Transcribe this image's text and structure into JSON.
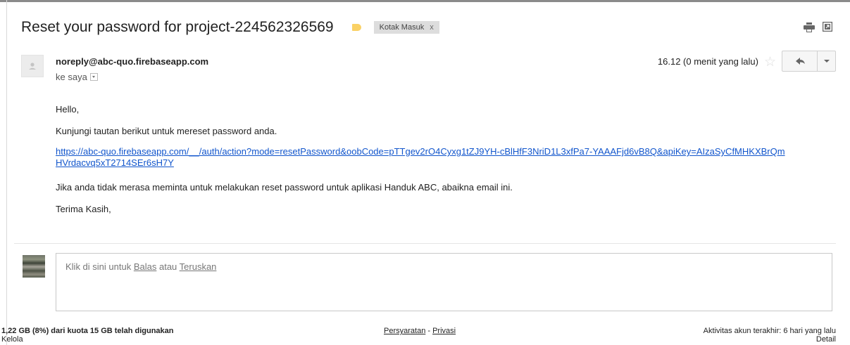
{
  "email": {
    "subject": "Reset your password for project-224562326569",
    "label_chip": "Kotak Masuk",
    "label_chip_close": "x",
    "sender": "noreply@abc-quo.firebaseapp.com",
    "recipient": "ke saya",
    "time": "16.12 (0 menit yang lalu)",
    "body": {
      "greeting": "Hello,",
      "line1": "Kunjungi tautan berikut untuk mereset password anda.",
      "link": "https://abc-quo.firebaseapp.com/__/auth/action?mode=resetPassword&oobCode=pTTgev2rO4Cyxg1tZJ9YH-cBlHfF3NriD1L3xfPa7-YAAAFjd6vB8Q&apiKey=AIzaSyCfMHKXBrQmHVrdacvq5xT2714SEr6sH7Y",
      "line2": "Jika anda tidak merasa meminta untuk melakukan reset password untuk aplikasi Handuk ABC, abaikna email ini.",
      "closing": "Terima Kasih,"
    }
  },
  "reply": {
    "prompt_prefix": "Klik di sini untuk ",
    "reply_link": "Balas",
    "connector": " atau ",
    "forward_link": "Teruskan"
  },
  "footer": {
    "storage": "1,22 GB (8%) dari kuota 15 GB telah digunakan",
    "manage": "Kelola",
    "terms": "Persyaratan",
    "separator": " - ",
    "privacy": "Privasi",
    "activity": "Aktivitas akun terakhir: 6 hari yang lalu",
    "details": "Detail"
  },
  "colors": {
    "label_tag": "#fad165",
    "link": "#1155cc"
  },
  "icons": [
    "print-icon",
    "new-window-icon",
    "star-icon",
    "reply-arrow-icon",
    "chevron-down-icon"
  ]
}
